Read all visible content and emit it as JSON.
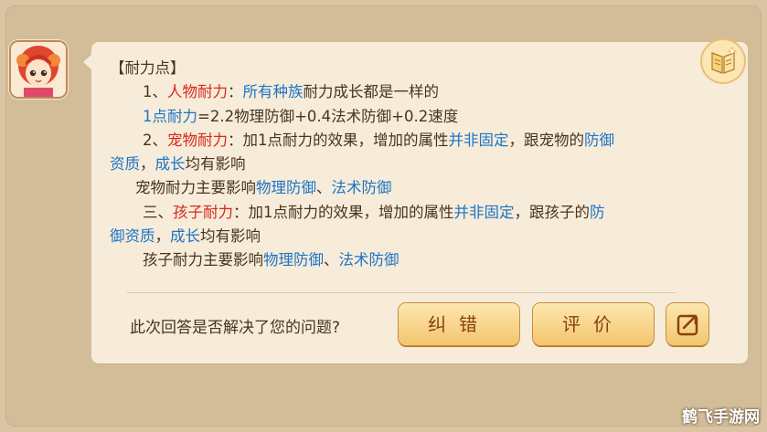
{
  "heading": "【耐力点】",
  "lines": {
    "l1a": "1、",
    "l1b": "人物耐力",
    "l1c": "：",
    "l1d": "所有种族",
    "l1e": "耐力成长都是一样的",
    "l2a": "1点耐力",
    "l2b": "=2.2物理防御+0.4法术防御+0.2速度",
    "l3a": "2、",
    "l3b": "宠物耐力",
    "l3c": "：加1点耐力的效果，增加的属性",
    "l3d": "并非固定",
    "l3e": "，跟宠物的",
    "l3f": "防御",
    "l4a": "资质",
    "l4b": "，",
    "l4c": "成长",
    "l4d": "均有影响",
    "l5a": "宠物耐力主要影响",
    "l5b": "物理防御",
    "l5c": "、",
    "l5d": "法术防御",
    "l6a": "三、",
    "l6b": "孩子耐力",
    "l6c": "：加1点耐力的效果，增加的属性",
    "l6d": "并非固定",
    "l6e": "，跟孩子的",
    "l6f": "防",
    "l7a": "御资质",
    "l7b": "，",
    "l7c": "成长",
    "l7d": "均有影响",
    "l8a": "孩子耐力主要影响",
    "l8b": "物理防御",
    "l8c": "、",
    "l8d": "法术防御"
  },
  "feedback": {
    "question": "此次回答是否解决了您的问题?",
    "fix_label": "纠错",
    "rate_label": "评价"
  },
  "watermark": "鹤飞手游网",
  "icons": {
    "avatar": "character-avatar",
    "book": "book-icon",
    "share": "share-icon"
  },
  "colors": {
    "highlight": "#1d74c7",
    "red": "#d9271d",
    "button_text": "#8a3f0e"
  }
}
